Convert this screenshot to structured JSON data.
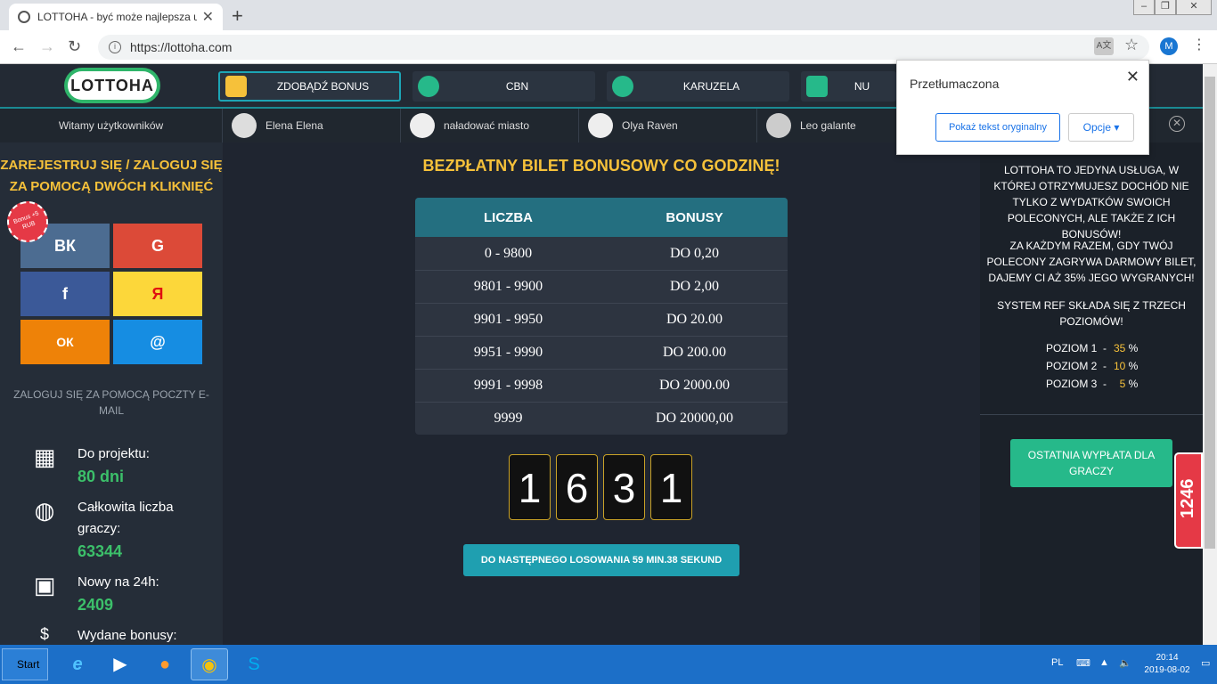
{
  "browser": {
    "tab_title": "LOTTOHA - być może najlepsza usługa",
    "url": "https://lottoha.com",
    "profile_initial": "M",
    "win_min": "–",
    "win_max": "❐",
    "win_close": "✕"
  },
  "translate_popup": {
    "title": "Przetłumaczona",
    "show_original": "Pokaż tekst oryginalny",
    "options": "Opcje ▾"
  },
  "header": {
    "logo": "LOTTOHA",
    "nav": [
      "ZDOBĄDŹ BONUS",
      "CBN",
      "KARUZELA",
      "NU"
    ]
  },
  "userbar": {
    "welcome": "Witamy użytkowników",
    "users": [
      "Elena Elena",
      "naładować miasto",
      "Olya Raven",
      "Leo galante"
    ]
  },
  "left": {
    "register_title": "ZAREJESTRUJ SIĘ / ZALOGUJ SIĘ ZA POMOCĄ DWÓCH KLIKNIĘĆ",
    "bonus_seal": "Bonus +5 RUB",
    "social": {
      "vk": "ВК",
      "google": "G",
      "facebook": "f",
      "yandex": "Я",
      "ok": "ОК",
      "mail": "@"
    },
    "email_login": "ZALOGUJ SIĘ ZA POMOCĄ POCZTY E-MAIL",
    "stats": [
      {
        "label": "Do projektu:",
        "value": "80 dni"
      },
      {
        "label": "Całkowita liczba graczy:",
        "value": "63344"
      },
      {
        "label": "Nowy na 24h:",
        "value": "2409"
      },
      {
        "label": "Wydane bonusy:",
        "value": ""
      }
    ]
  },
  "main": {
    "title": "BEZPŁATNY BILET BONUSOWY CO GODZINĘ!",
    "table": {
      "headers": [
        "LICZBA",
        "BONUSY"
      ],
      "rows": [
        [
          "0 - 9800",
          "DO 0,20"
        ],
        [
          "9801 - 9900",
          "DO 2,00"
        ],
        [
          "9901 - 9950",
          "DO 20.00"
        ],
        [
          "9951 - 9990",
          "DO 200.00"
        ],
        [
          "9991 - 9998",
          "DO 2000.00"
        ],
        [
          "9999",
          "DO 20000,00"
        ]
      ]
    },
    "digits": [
      "1",
      "6",
      "3",
      "1"
    ],
    "next_draw": "DO NASTĘPNEGO LOSOWANIA 59 MIN.38 SEKUND"
  },
  "right": {
    "p1": "LOTTOHA TO JEDYNA USŁUGA, W KTÓREJ OTRZYMUJESZ DOCHÓD NIE TYLKO Z WYDATKÓW SWOICH POLECONYCH, ALE TAKŻE Z ICH BONUSÓW!",
    "p2": "ZA KAŻDYM RAZEM, GDY TWÓJ POLECONY ZAGRYWA DARMOWY BILET, DAJEMY CI AŻ 35% JEGO WYGRANYCH!",
    "p3": "SYSTEM REF SKŁADA SIĘ Z TRZECH POZIOMÓW!",
    "levels": [
      {
        "label": "POZIOM 1",
        "pct": "35"
      },
      {
        "label": "POZIOM 2",
        "pct": "10"
      },
      {
        "label": "POZIOM 3",
        "pct": "5"
      }
    ],
    "payout_button": "OSTATNIA WYPŁATA DLA GRACZY",
    "badge": "1246"
  },
  "taskbar": {
    "start": "Start",
    "lang": "PL",
    "time": "20:14",
    "date": "2019-08-02"
  }
}
